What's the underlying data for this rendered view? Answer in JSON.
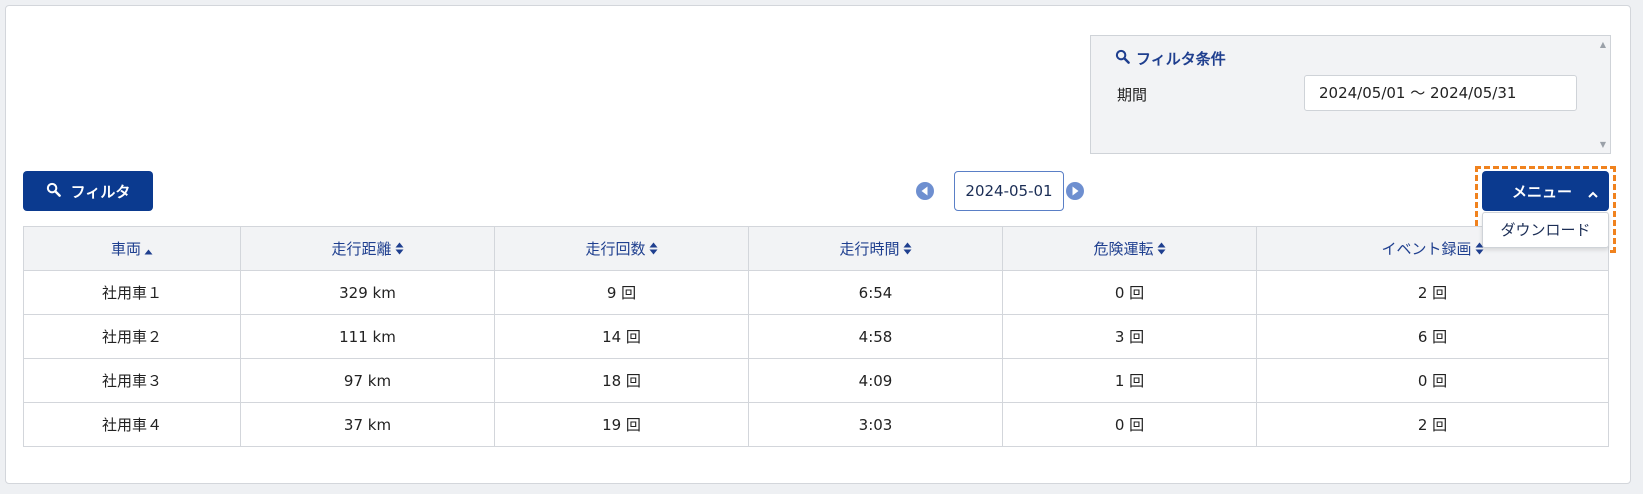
{
  "filter": {
    "title": "フィルタ条件",
    "period_label": "期間",
    "period_value": "2024/05/01 〜 2024/05/31",
    "button_label": "フィルタ"
  },
  "date_nav": {
    "current_date": "2024-05-01"
  },
  "menu": {
    "button_label": "メニュー",
    "items": [
      "ダウンロード"
    ]
  },
  "table": {
    "columns": [
      {
        "label": "車両",
        "sort": "asc"
      },
      {
        "label": "走行距離",
        "sort": "none"
      },
      {
        "label": "走行回数",
        "sort": "none"
      },
      {
        "label": "走行時間",
        "sort": "none"
      },
      {
        "label": "危険運転",
        "sort": "none"
      },
      {
        "label": "イベント録画",
        "sort": "none"
      }
    ],
    "rows": [
      [
        "社用車１",
        "329 km",
        "9 回",
        "6:54",
        "0 回",
        "2 回"
      ],
      [
        "社用車２",
        "111 km",
        "14 回",
        "4:58",
        "3 回",
        "6 回"
      ],
      [
        "社用車３",
        "97 km",
        "18 回",
        "4:09",
        "1 回",
        "0 回"
      ],
      [
        "社用車４",
        "37 km",
        "19 回",
        "3:03",
        "0 回",
        "2 回"
      ]
    ]
  },
  "colors": {
    "primary": "#0b3a8f",
    "header_text": "#1f3f8f",
    "highlight": "#f0821e",
    "nav_arrow": "#6e8fd0"
  },
  "icons": {
    "filter": "search-icon",
    "prev": "prev-circle-icon",
    "next": "next-circle-icon",
    "menu": "chevron-up-icon",
    "sort_asc": "sort-asc-icon",
    "sort_both": "sort-both-icon"
  }
}
